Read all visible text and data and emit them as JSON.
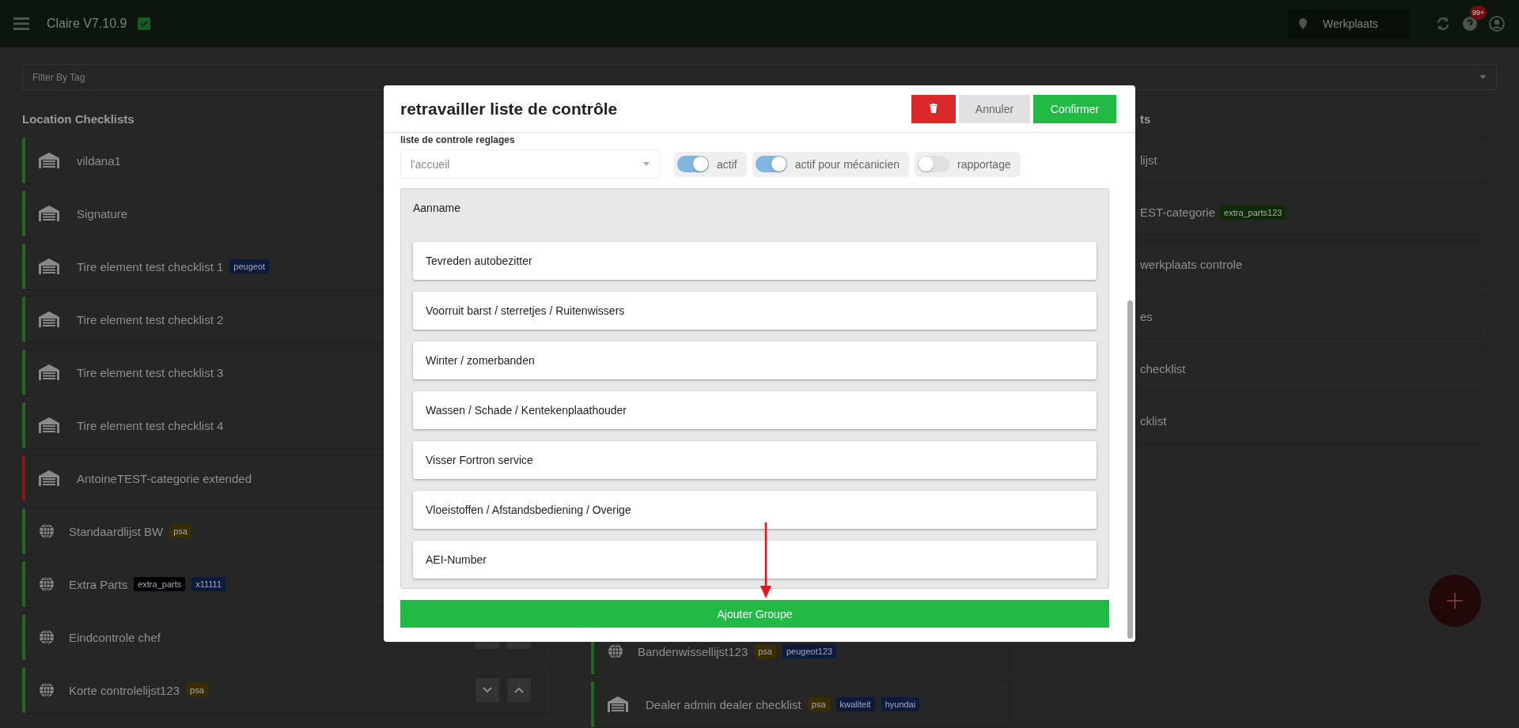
{
  "app_bar": {
    "title": "Claire V7.10.9",
    "location": "Werkplaats",
    "notification_badge": "99+"
  },
  "filter": {
    "placeholder": "Filter By Tag"
  },
  "left_column": {
    "heading": "Location Checklists",
    "items": [
      {
        "name": "vildana1",
        "kind": "garage",
        "color": "#1f6a1f"
      },
      {
        "name": "Signature",
        "kind": "garage",
        "color": "#1f6a1f"
      },
      {
        "name": "Tire element test checklist 1",
        "kind": "garage",
        "color": "#1f6a1f",
        "tags": [
          {
            "label": "peugeot",
            "color": "#0c1a3c"
          }
        ]
      },
      {
        "name": "Tire element test checklist 2",
        "kind": "garage",
        "color": "#1f6a1f"
      },
      {
        "name": "Tire element test checklist 3",
        "kind": "garage",
        "color": "#1f6a1f"
      },
      {
        "name": "Tire element test checklist 4",
        "kind": "garage",
        "color": "#1f6a1f"
      },
      {
        "name": "AntoineTEST-categorie extended",
        "kind": "garage",
        "color": "#8a1a1a"
      },
      {
        "name": "Standaardlijst BW",
        "kind": "globe",
        "color": "#1f6a1f",
        "tags": [
          {
            "label": "psa",
            "color": "#3a2d00"
          }
        ]
      },
      {
        "name": "Extra Parts",
        "kind": "globe",
        "color": "#1f6a1f",
        "tags": [
          {
            "label": "extra_parts",
            "color": "#000000"
          },
          {
            "label": "x11111",
            "color": "#0c1a3c"
          }
        ]
      },
      {
        "name": "Eindcontrole chef",
        "kind": "globe",
        "color": "#1f6a1f",
        "sortable": true
      },
      {
        "name": "Korte controlelijst123",
        "kind": "globe",
        "color": "#1f6a1f",
        "tags": [
          {
            "label": "psa",
            "color": "#3a2d00"
          }
        ],
        "sortable": true
      }
    ]
  },
  "middle_column": {
    "items": [
      {
        "name": "Bandenwissellijst123",
        "kind": "globe",
        "color": "#1f6a1f",
        "tags": [
          {
            "label": "psa",
            "color": "#3a2d00"
          },
          {
            "label": "peugeot123",
            "color": "#0c1a3c"
          }
        ]
      },
      {
        "name": "Dealer admin dealer checklist",
        "kind": "garage",
        "color": "#1f6a1f",
        "tags": [
          {
            "label": "psa",
            "color": "#3a2d00"
          },
          {
            "label": "kwaliteit",
            "color": "#0c1a3c"
          },
          {
            "label": "hyundai",
            "color": "#0c1a3c"
          }
        ]
      }
    ]
  },
  "right_column": {
    "heading": "ts",
    "items": [
      {
        "name": "lijst"
      },
      {
        "name": "EST-categorie",
        "tags": [
          {
            "label": "extra_parts123",
            "color": "#0f2a00"
          }
        ]
      },
      {
        "name": "werkplaats controle"
      },
      {
        "name": "es"
      },
      {
        "name": "checklist"
      },
      {
        "name": "cklist"
      }
    ]
  },
  "modal": {
    "title": "retravailler liste de contrôle",
    "buttons": {
      "cancel": "Annuler",
      "confirm": "Confirmer"
    },
    "section_label": "liste de controle reglages",
    "select": {
      "placeholder": "l'accueil"
    },
    "toggles": [
      {
        "label": "actif",
        "on": true
      },
      {
        "label": "actif pour mécanicien",
        "on": true
      },
      {
        "label": "rapportage",
        "on": false
      }
    ],
    "group": {
      "title": "Aanname",
      "items": [
        "Tevreden autobezitter",
        "Voorruit barst / sterretjes / Ruitenwissers",
        "Winter / zomerbanden",
        "Wassen / Schade / Kentekenplaathouder",
        "Visser Fortron service",
        "Vloeistoffen / Afstandsbediening / Overige",
        "AEI-Number"
      ]
    },
    "add_group_button": "Ajouter Groupe"
  }
}
